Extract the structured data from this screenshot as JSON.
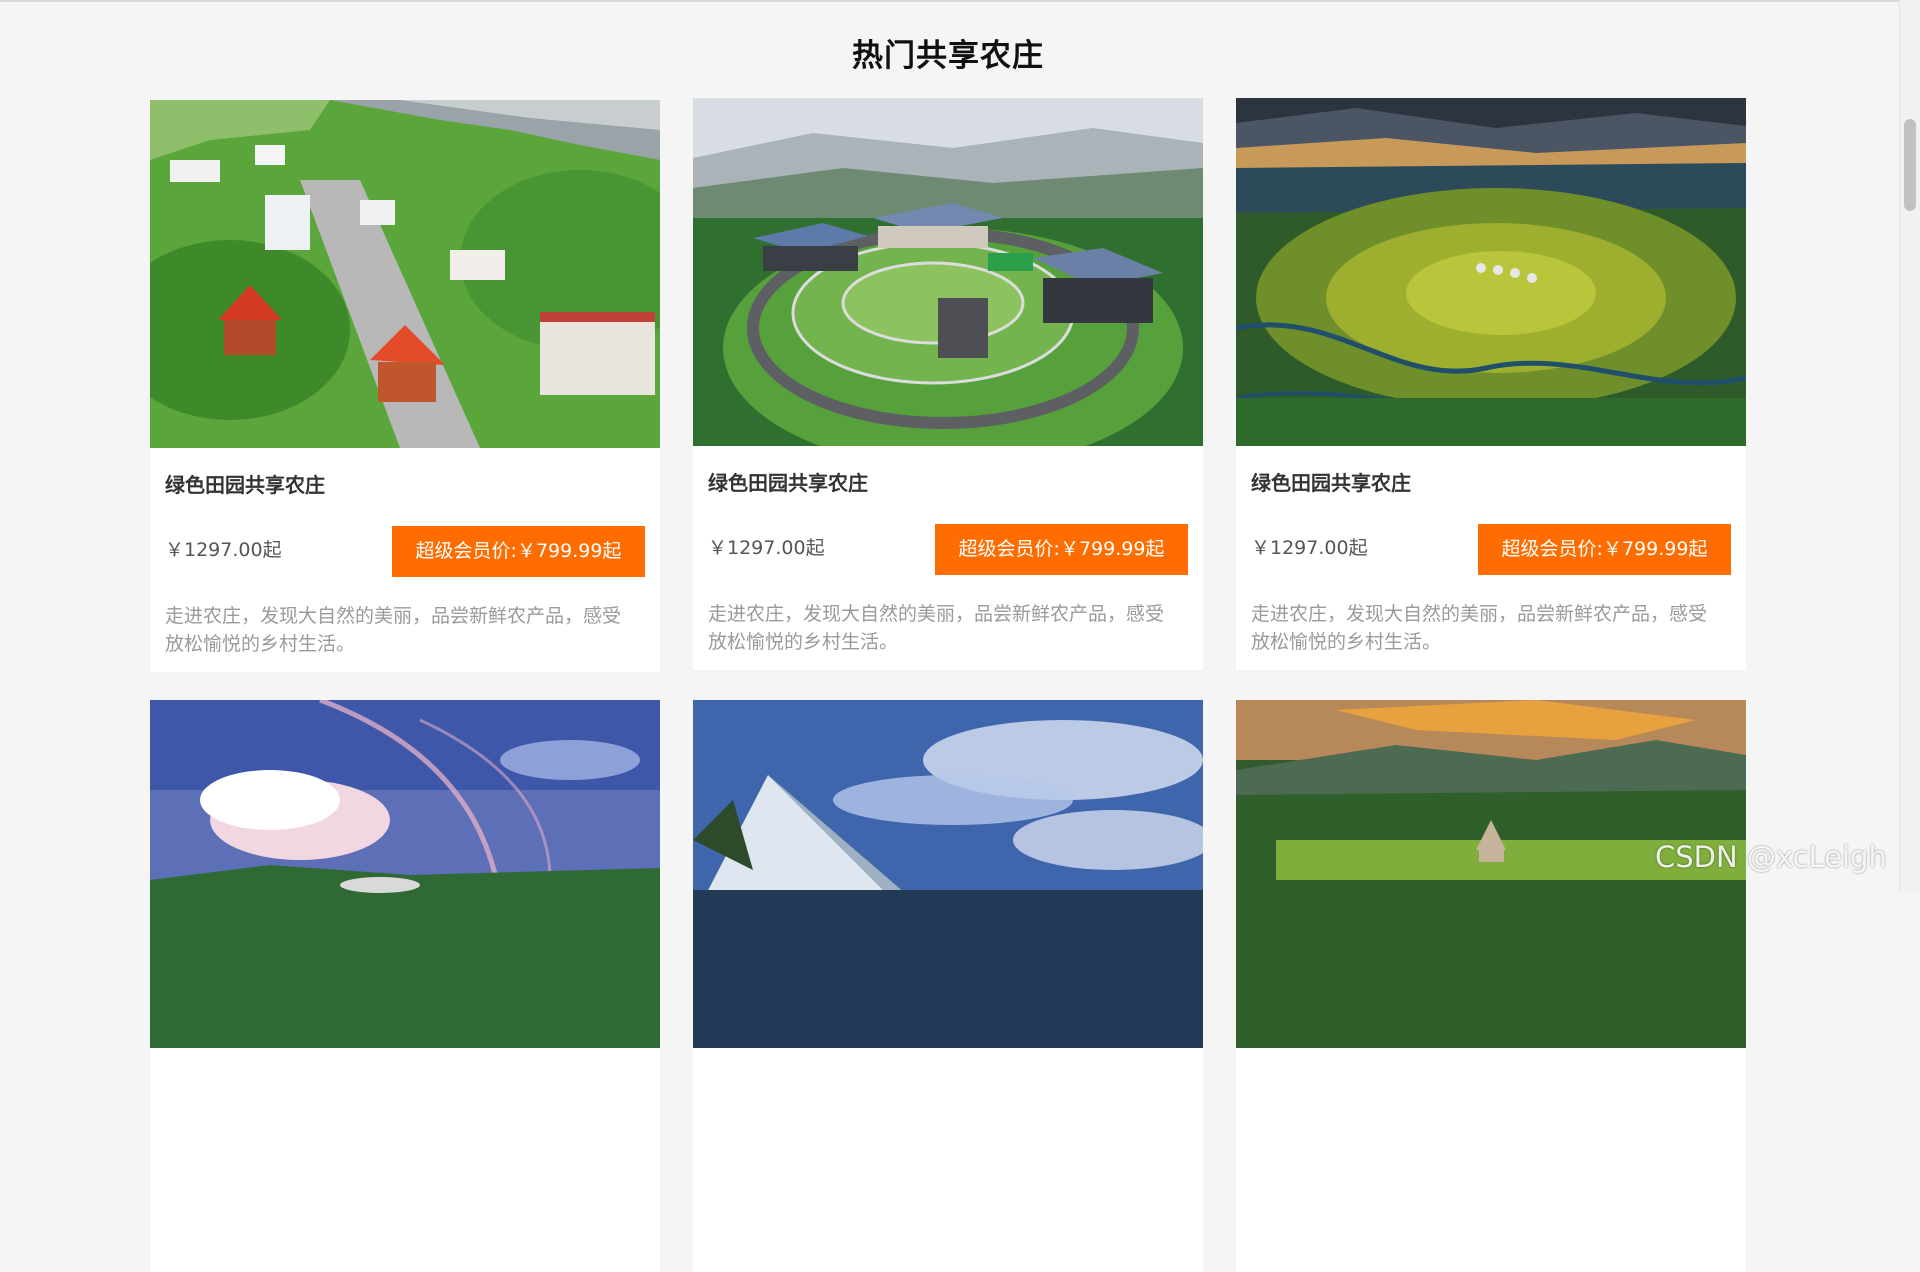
{
  "page": {
    "title": "热门共享农庄"
  },
  "cards": [
    {
      "name": "绿色田园共享农庄",
      "price": "￥1297.00起",
      "vip_price": "超级会员价:￥799.99起",
      "description": "走进农庄，发现大自然的美丽，品尝新鲜农产品，感受放松愉悦的乡村生活。"
    },
    {
      "name": "绿色田园共享农庄",
      "price": "￥1297.00起",
      "vip_price": "超级会员价:￥799.99起",
      "description": "走进农庄，发现大自然的美丽，品尝新鲜农产品，感受放松愉悦的乡村生活。"
    },
    {
      "name": "绿色田园共享农庄",
      "price": "￥1297.00起",
      "vip_price": "超级会员价:￥799.99起",
      "description": "走进农庄，发现大自然的美丽，品尝新鲜农产品，感受放松愉悦的乡村生活。"
    },
    {},
    {},
    {}
  ],
  "watermark": "CSDN @xcLeigh",
  "colors": {
    "accent": "#ff6d00",
    "background": "#f5f5f5"
  }
}
